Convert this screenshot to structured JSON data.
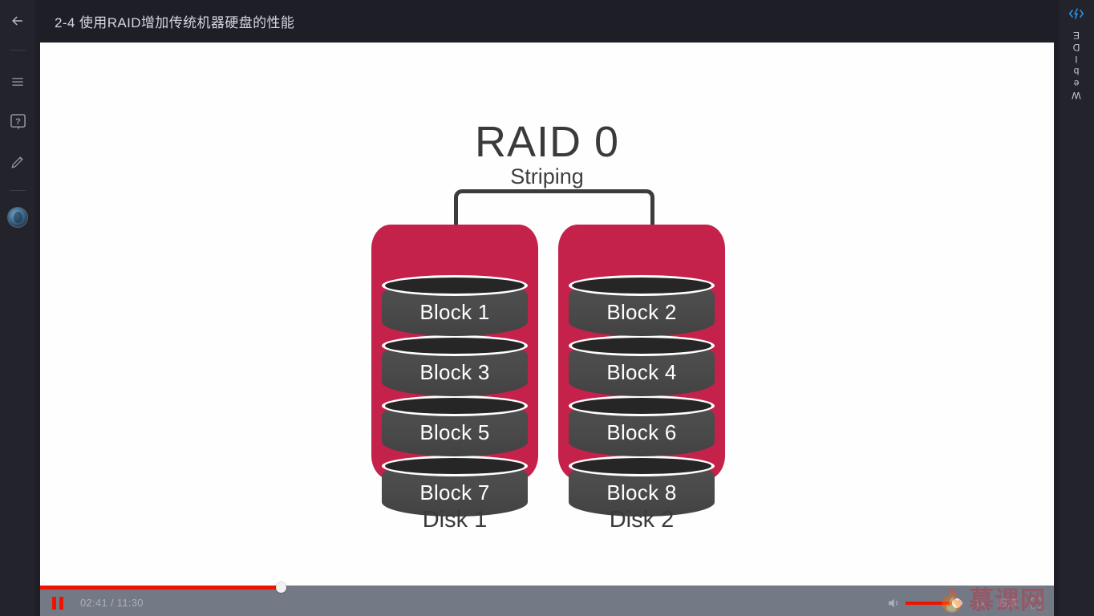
{
  "header": {
    "back_icon": "arrow-left-icon",
    "title": "2-4 使用RAID增加传统机器硬盘的性能"
  },
  "sidebar": {
    "items": [
      {
        "icon": "menu-icon",
        "label": "菜单"
      },
      {
        "icon": "question-mark-icon",
        "label": "帮助"
      },
      {
        "icon": "pencil-icon",
        "label": "笔记"
      }
    ],
    "avatar_label": "用户头像"
  },
  "webide": {
    "icon": "code-lightning-icon",
    "label": "WebIDE",
    "accent_color": "#2f8fe0"
  },
  "slide": {
    "title": "RAID 0",
    "subtitle": "Striping",
    "shell_color": "#c4214b",
    "cylinder_color": "#4a4a4a",
    "disks": [
      {
        "label": "Disk 1",
        "blocks": [
          "Block 1",
          "Block 3",
          "Block 5",
          "Block 7"
        ]
      },
      {
        "label": "Disk 2",
        "blocks": [
          "Block 2",
          "Block 4",
          "Block 6",
          "Block 8"
        ]
      }
    ]
  },
  "player": {
    "play_state_icon": "pause-icon",
    "current_time": "02:41",
    "duration": "11:30",
    "time_display": "02:41 / 11:30",
    "progress_percent": 23.7,
    "volume_icon": "volume-on-icon",
    "volume_percent": 88,
    "speed_label": "1x",
    "quality_label": "超清",
    "fullscreen_icon": "fullscreen-icon",
    "accent_color": "#f01400"
  },
  "watermark": {
    "icon": "flame-icon",
    "text": "慕课网"
  }
}
